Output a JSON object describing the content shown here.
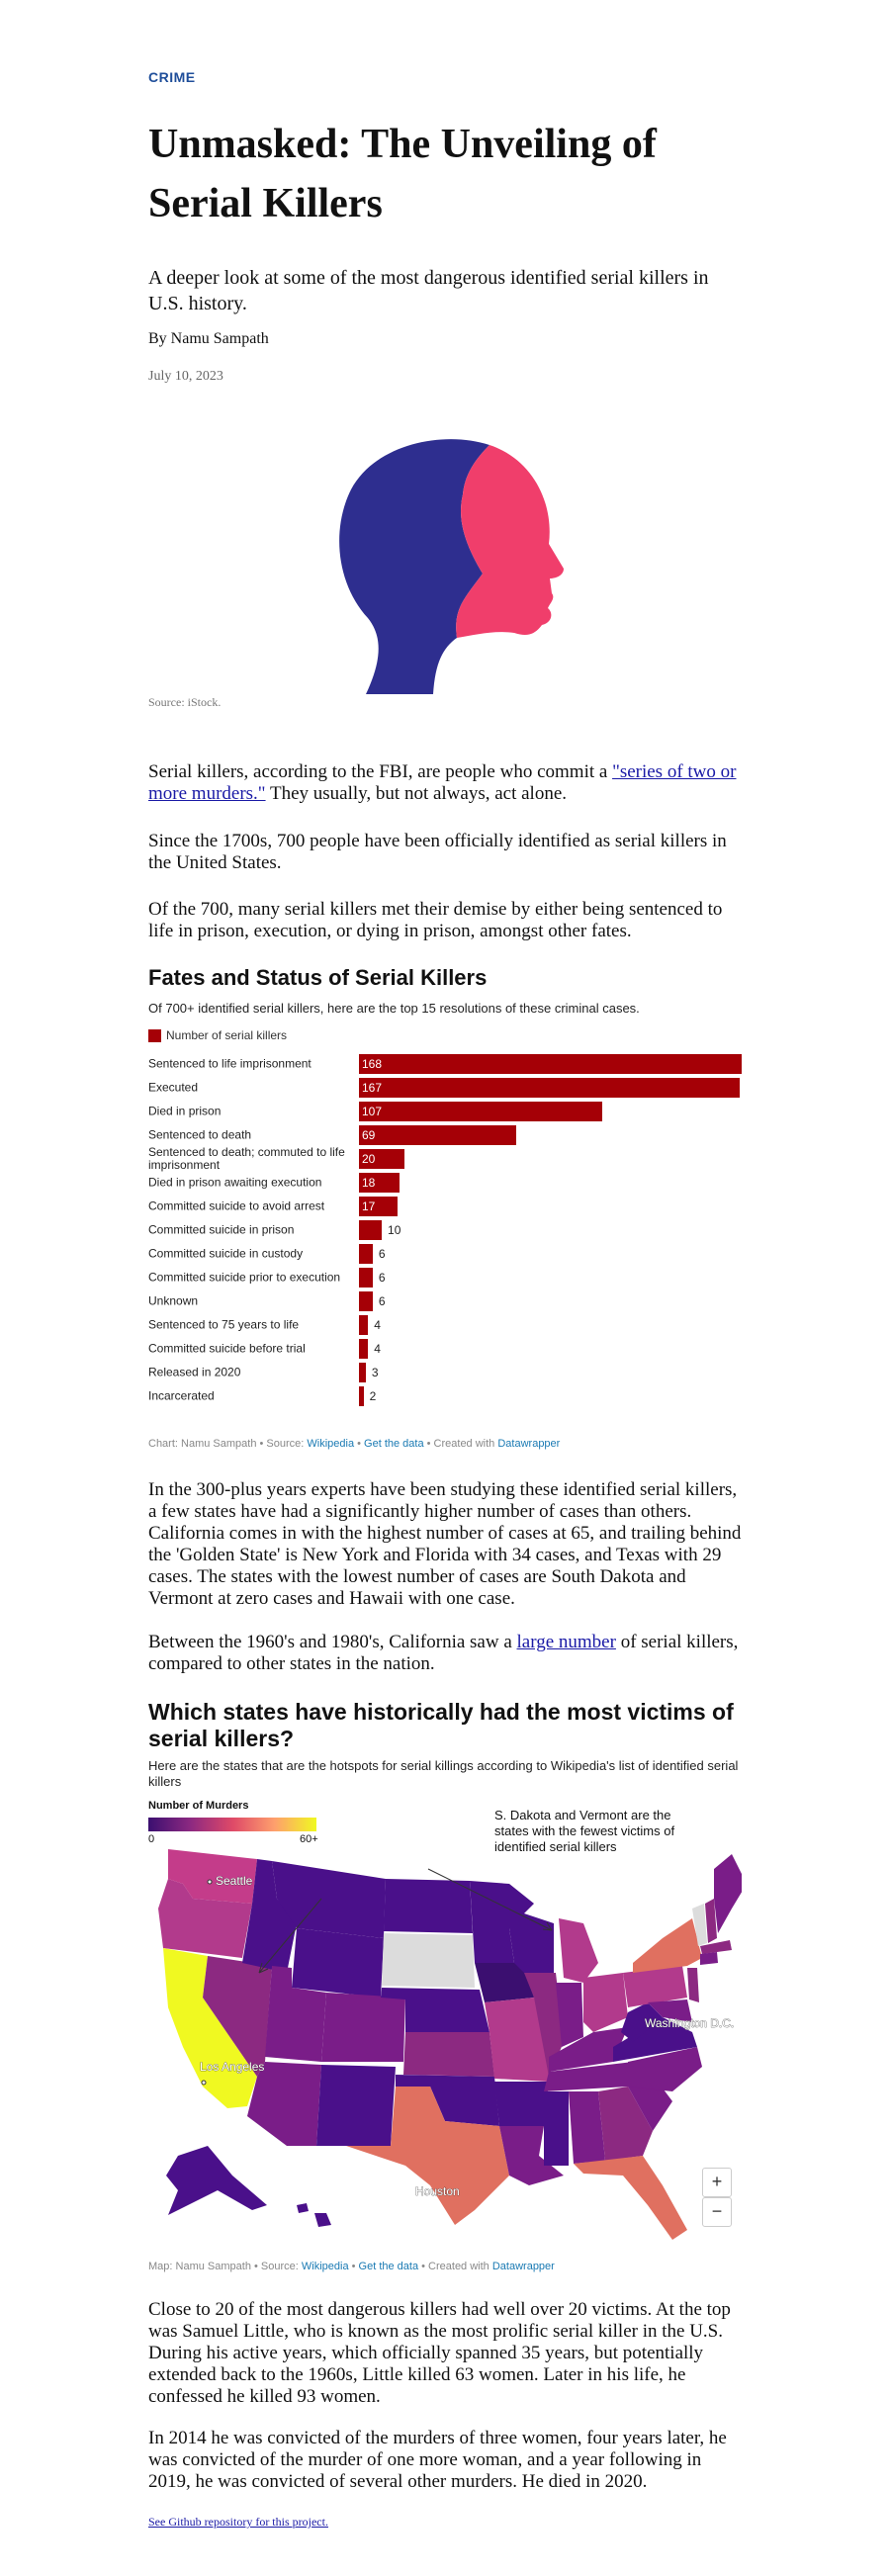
{
  "article": {
    "kicker": "CRIME",
    "title": "Unmasked: The Unveiling of Serial Killers",
    "dek": "A deeper look at some of the most dangerous identified serial killers in U.S. history.",
    "byline": "By Namu Sampath",
    "date": "July 10, 2023",
    "image_caption": "Source: iStock.",
    "colors": {
      "kicker": "#1f4e9a",
      "head_back": "#2e2e8f",
      "head_front": "#f03e6b",
      "bar": "#a50006"
    }
  },
  "paragraphs": {
    "p1_pre": "Serial killers, according to the FBI, are people who commit a ",
    "p1_link": "\"series of two or more murders.\"",
    "p1_post": " They usually, but not always, act alone.",
    "p2": "Since the 1700s, 700 people have been officially identified as serial killers in the United States.",
    "p3": "Of the 700, many serial killers met their demise by either being sentenced to life in prison, execution, or dying in prison, amongst other fates.",
    "p4": "In the 300-plus years experts have been studying these identified serial killers, a few states have had a significantly higher number of cases than others. California comes in with the highest number of cases at 65, and trailing behind the 'Golden State' is New York and Florida with 34 cases, and Texas with 29 cases. The states with the lowest number of cases are South Dakota and Vermont at zero cases and Hawaii with one case.",
    "p5_pre": "Between the 1960's and 1980's, California saw a ",
    "p5_link": "large number",
    "p5_post": " of serial killers, compared to other states in the nation.",
    "p6": "Close to 20 of the most dangerous killers had well over 20 victims. At the top was Samuel Little, who is known as the most prolific serial killer in the U.S. During his active years, which officially spanned 35 years, but potentially extended back to the 1960s, Little killed 63 women. Later in his life, he confessed he killed 93 women.",
    "p7": "In 2014 he was convicted of the murders of three women, four years later, he was convicted of the murder of one more woman, and a year following in 2019, he was convicted of several other murders. He died in 2020.",
    "footer_link": "See Github repository for this project."
  },
  "chart1": {
    "title": "Fates and Status of Serial Killers",
    "subtitle": "Of 700+ identified serial killers, here are the top 15 resolutions of these criminal cases.",
    "legend": "Number of serial killers",
    "note_prefix": "Chart: Namu Sampath • Source: ",
    "note_source": "Wikipedia",
    "note_sep1": " • ",
    "note_get": "Get the data",
    "note_sep2": " • Created with ",
    "note_dw": "Datawrapper"
  },
  "chart_data": {
    "type": "bar",
    "orientation": "horizontal",
    "categories": [
      "Sentenced to life imprisonment",
      "Executed",
      "Died in prison",
      "Sentenced to death",
      "Sentenced to death; commuted to life imprisonment",
      "Died in prison awaiting execution",
      "Committed suicide to avoid arrest",
      "Committed suicide in prison",
      "Committed suicide in custody",
      "Committed suicide prior to execution",
      "Unknown",
      "Sentenced to 75 years to life",
      "Committed suicide before trial",
      "Released in 2020",
      "Incarcerated"
    ],
    "series": [
      {
        "name": "Number of serial killers",
        "values": [
          168,
          167,
          107,
          69,
          20,
          18,
          17,
          10,
          6,
          6,
          6,
          4,
          4,
          3,
          2
        ],
        "color": "#a50006"
      }
    ],
    "xlim": [
      0,
      168
    ],
    "grid": false,
    "legend_position": "top-left"
  },
  "map": {
    "title": "Which states have historically had the most victims of serial killers?",
    "subtitle": "Here are the states that are the hotspots for serial killings according to Wikipedia's list of identified serial killers",
    "legend_title": "Number of Murders",
    "legend_min": "0",
    "legend_max": "60+",
    "annotation": "S. Dakota and Vermont are the states with the fewest victims of identified serial killers",
    "cities": [
      "Seattle",
      "Los Angeles",
      "Houston",
      "Washington D.C."
    ],
    "zoom_in": "+",
    "zoom_out": "−",
    "note_prefix": "Map: Namu Sampath • Source: ",
    "note_source": "Wikipedia",
    "note_sep1": " • ",
    "note_get": "Get the data",
    "note_sep2": " • Created with ",
    "note_dw": "Datawrapper",
    "scale_colors": [
      "#3b0f70",
      "#8c2981",
      "#de4968",
      "#fe9f6d",
      "#f0f921"
    ]
  }
}
